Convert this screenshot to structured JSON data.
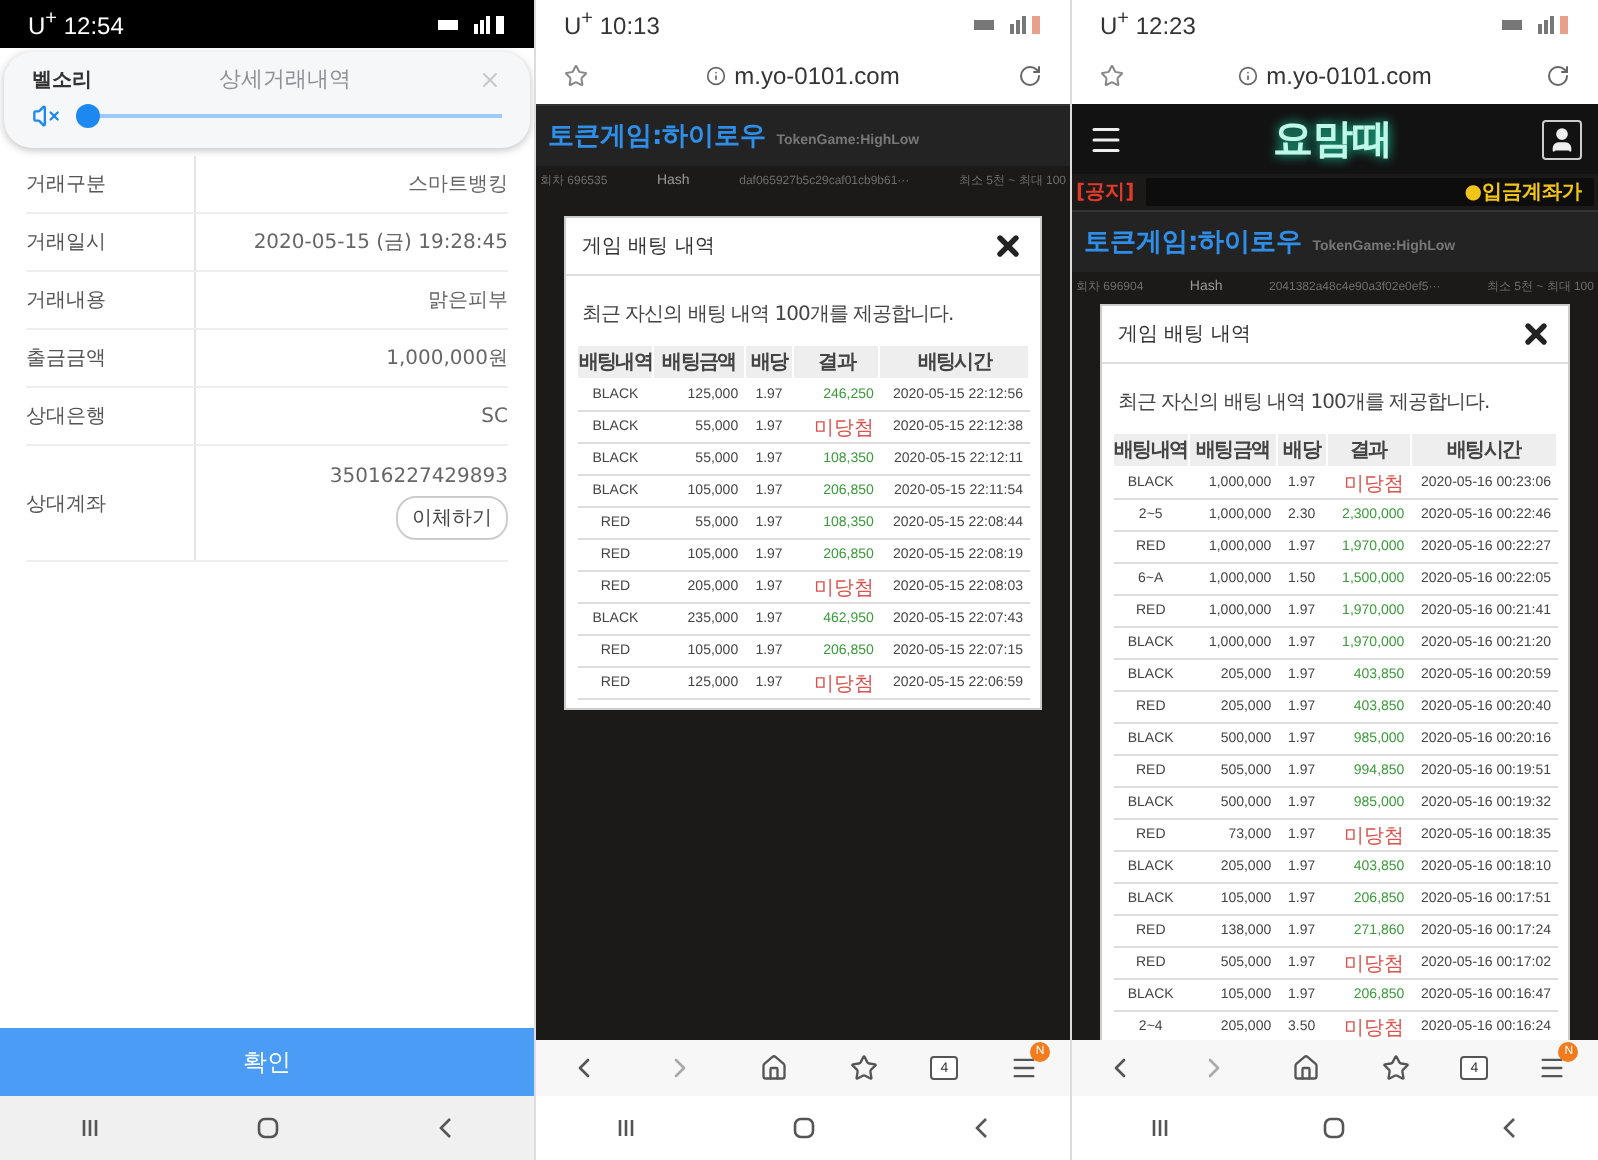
{
  "phones": [
    {
      "kind": "bank",
      "status": {
        "carrier": "U$^{+}$",
        "time": "12:54"
      },
      "volume_popup": {
        "label": "벨소리",
        "muted": true,
        "level": 0.0
      },
      "title": "상세거래내역",
      "rows": [
        {
          "label": "거래구분",
          "value": "스마트뱅킹"
        },
        {
          "label": "거래일시",
          "value": "2020-05-15 (금) 19:28:45"
        },
        {
          "label": "거래내용",
          "value": "맑은피부"
        },
        {
          "label": "출금금액",
          "value": "1,000,000원"
        },
        {
          "label": "상대은행",
          "value": "SC"
        },
        {
          "label": "상대계좌",
          "value": "35016227429893",
          "action": "이체하기"
        }
      ],
      "confirm": "확인"
    },
    {
      "kind": "game",
      "status": {
        "carrier": "U$^{+}$",
        "time": "10:13"
      },
      "url": "m.yo-0101.com",
      "site": {
        "title": "토큰게임:하이로우",
        "subtitle": "TokenGame:HighLow",
        "round": "회차 696535",
        "hash_label": "Hash",
        "hash": "daf065927b5c29caf01cb9b61···",
        "limit": "최소 5천 ~ 최대 100"
      },
      "modal": {
        "title": "게임 배팅 내역",
        "note": "최근 자신의 배팅 내역 100개를 제공합니다.",
        "columns": [
          "배팅내역",
          "배팅금액",
          "배당",
          "결과",
          "배팅시간"
        ],
        "rows": [
          {
            "bet": "BLACK",
            "amount": "125,000",
            "odds": "1.97",
            "result": "246,250",
            "time": "2020-05-15 22:12:56",
            "kind": "win"
          },
          {
            "bet": "BLACK",
            "amount": "55,000",
            "odds": "1.97",
            "result": "미당첨",
            "time": "2020-05-15 22:12:38",
            "kind": "lose"
          },
          {
            "bet": "BLACK",
            "amount": "55,000",
            "odds": "1.97",
            "result": "108,350",
            "time": "2020-05-15 22:12:11",
            "kind": "win"
          },
          {
            "bet": "BLACK",
            "amount": "105,000",
            "odds": "1.97",
            "result": "206,850",
            "time": "2020-05-15 22:11:54",
            "kind": "win"
          },
          {
            "bet": "RED",
            "amount": "55,000",
            "odds": "1.97",
            "result": "108,350",
            "time": "2020-05-15 22:08:44",
            "kind": "win"
          },
          {
            "bet": "RED",
            "amount": "105,000",
            "odds": "1.97",
            "result": "206,850",
            "time": "2020-05-15 22:08:19",
            "kind": "win"
          },
          {
            "bet": "RED",
            "amount": "205,000",
            "odds": "1.97",
            "result": "미당첨",
            "time": "2020-05-15 22:08:03",
            "kind": "lose"
          },
          {
            "bet": "BLACK",
            "amount": "235,000",
            "odds": "1.97",
            "result": "462,950",
            "time": "2020-05-15 22:07:43",
            "kind": "win"
          },
          {
            "bet": "RED",
            "amount": "105,000",
            "odds": "1.97",
            "result": "206,850",
            "time": "2020-05-15 22:07:15",
            "kind": "win"
          },
          {
            "bet": "RED",
            "amount": "125,000",
            "odds": "1.97",
            "result": "미당첨",
            "time": "2020-05-15 22:06:59",
            "kind": "lose"
          }
        ]
      },
      "tabs_count": "4",
      "menu_badge": "N"
    },
    {
      "kind": "game",
      "status": {
        "carrier": "U$^{+}$",
        "time": "12:23"
      },
      "url": "m.yo-0101.com",
      "site": {
        "logo": "요맘때",
        "notice_tag": "[공지]",
        "notice": "●입금계좌가",
        "title": "토큰게임:하이로우",
        "subtitle": "TokenGame:HighLow",
        "round": "회차 696904",
        "hash_label": "Hash",
        "hash": "2041382a48c4e90a3f02e0ef5···",
        "limit": "최소 5천 ~ 최대 100"
      },
      "modal": {
        "title": "게임 배팅 내역",
        "note": "최근 자신의 배팅 내역 100개를 제공합니다.",
        "columns": [
          "배팅내역",
          "배팅금액",
          "배당",
          "결과",
          "배팅시간"
        ],
        "rows": [
          {
            "bet": "BLACK",
            "amount": "1,000,000",
            "odds": "1.97",
            "result": "미당첨",
            "time": "2020-05-16 00:23:06",
            "kind": "lose"
          },
          {
            "bet": "2~5",
            "amount": "1,000,000",
            "odds": "2.30",
            "result": "2,300,000",
            "time": "2020-05-16 00:22:46",
            "kind": "win"
          },
          {
            "bet": "RED",
            "amount": "1,000,000",
            "odds": "1.97",
            "result": "1,970,000",
            "time": "2020-05-16 00:22:27",
            "kind": "win"
          },
          {
            "bet": "6~A",
            "amount": "1,000,000",
            "odds": "1.50",
            "result": "1,500,000",
            "time": "2020-05-16 00:22:05",
            "kind": "win"
          },
          {
            "bet": "RED",
            "amount": "1,000,000",
            "odds": "1.97",
            "result": "1,970,000",
            "time": "2020-05-16 00:21:41",
            "kind": "win"
          },
          {
            "bet": "BLACK",
            "amount": "1,000,000",
            "odds": "1.97",
            "result": "1,970,000",
            "time": "2020-05-16 00:21:20",
            "kind": "win"
          },
          {
            "bet": "BLACK",
            "amount": "205,000",
            "odds": "1.97",
            "result": "403,850",
            "time": "2020-05-16 00:20:59",
            "kind": "win"
          },
          {
            "bet": "RED",
            "amount": "205,000",
            "odds": "1.97",
            "result": "403,850",
            "time": "2020-05-16 00:20:40",
            "kind": "win"
          },
          {
            "bet": "BLACK",
            "amount": "500,000",
            "odds": "1.97",
            "result": "985,000",
            "time": "2020-05-16 00:20:16",
            "kind": "win"
          },
          {
            "bet": "RED",
            "amount": "505,000",
            "odds": "1.97",
            "result": "994,850",
            "time": "2020-05-16 00:19:51",
            "kind": "win"
          },
          {
            "bet": "BLACK",
            "amount": "500,000",
            "odds": "1.97",
            "result": "985,000",
            "time": "2020-05-16 00:19:32",
            "kind": "win"
          },
          {
            "bet": "RED",
            "amount": "73,000",
            "odds": "1.97",
            "result": "미당첨",
            "time": "2020-05-16 00:18:35",
            "kind": "lose"
          },
          {
            "bet": "BLACK",
            "amount": "205,000",
            "odds": "1.97",
            "result": "403,850",
            "time": "2020-05-16 00:18:10",
            "kind": "win"
          },
          {
            "bet": "BLACK",
            "amount": "105,000",
            "odds": "1.97",
            "result": "206,850",
            "time": "2020-05-16 00:17:51",
            "kind": "win"
          },
          {
            "bet": "RED",
            "amount": "138,000",
            "odds": "1.97",
            "result": "271,860",
            "time": "2020-05-16 00:17:24",
            "kind": "win"
          },
          {
            "bet": "RED",
            "amount": "505,000",
            "odds": "1.97",
            "result": "미당첨",
            "time": "2020-05-16 00:17:02",
            "kind": "lose"
          },
          {
            "bet": "BLACK",
            "amount": "105,000",
            "odds": "1.97",
            "result": "206,850",
            "time": "2020-05-16 00:16:47",
            "kind": "win"
          },
          {
            "bet": "2~4",
            "amount": "205,000",
            "odds": "3.50",
            "result": "미당첨",
            "time": "2020-05-16 00:16:24",
            "kind": "lose"
          }
        ]
      },
      "tabs_count": "4",
      "menu_badge": "N"
    }
  ]
}
